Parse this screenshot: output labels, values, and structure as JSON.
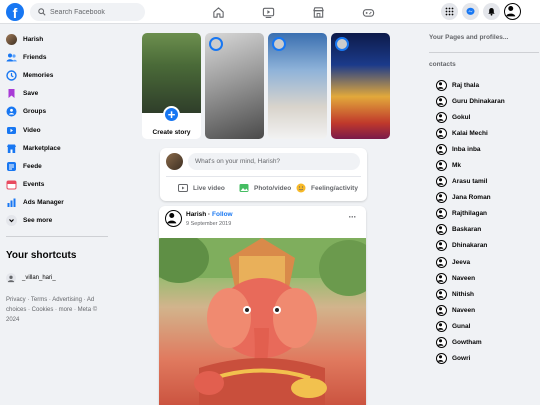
{
  "header": {
    "search_placeholder": "Search Facebook",
    "logo_text": "f"
  },
  "sidebar": {
    "user_name": "Harish",
    "items": [
      {
        "label": "Friends",
        "icon": "friends-icon",
        "color": "#1877f2"
      },
      {
        "label": "Memories",
        "icon": "clock-icon",
        "color": "#1877f2"
      },
      {
        "label": "Save",
        "icon": "bookmark-icon",
        "color": "#a83bd6"
      },
      {
        "label": "Groups",
        "icon": "groups-icon",
        "color": "#1877f2"
      },
      {
        "label": "Video",
        "icon": "video-icon",
        "color": "#1877f2"
      },
      {
        "label": "Marketplace",
        "icon": "shop-icon",
        "color": "#1877f2"
      },
      {
        "label": "Feede",
        "icon": "feed-icon",
        "color": "#1877f2"
      },
      {
        "label": "Events",
        "icon": "calendar-icon",
        "color": "#e84a5f"
      },
      {
        "label": "Ads Manager",
        "icon": "chart-icon",
        "color": "#1877f2"
      }
    ],
    "see_more": "See more",
    "shortcuts_title": "Your shortcuts",
    "shortcuts": [
      {
        "label": "_villan_hari_"
      }
    ],
    "footer": "Privacy · Terms · Advertising · Ad choices · Cookies · more · Meta © 2024"
  },
  "stories": {
    "create_label": "Create story"
  },
  "composer": {
    "placeholder": "What's on your mind, Harish?",
    "live_video": "Live video",
    "photo_video": "Photo/video",
    "feeling": "Feeling/activity"
  },
  "post": {
    "author": "Harish",
    "follow": "Follow",
    "date": "9 September 2019",
    "more": "···"
  },
  "right": {
    "pages_title": "Your Pages and profiles...",
    "contacts_title": "contacts",
    "contacts": [
      "Raj thala",
      "Guru Dhinakaran",
      "Gokul",
      "Kalai Mechi",
      "Inba inba",
      "Mk",
      "Arasu tamil",
      "Jana Roman",
      "Rajthilagan",
      "Baskaran",
      "Dhinakaran",
      "Jeeva",
      "Naveen",
      "Nithish",
      "Naveen",
      "Gunal",
      "Gowtham",
      "Gowri"
    ]
  },
  "colors": {
    "accent": "#1877f2",
    "background": "#f0f2f5"
  }
}
